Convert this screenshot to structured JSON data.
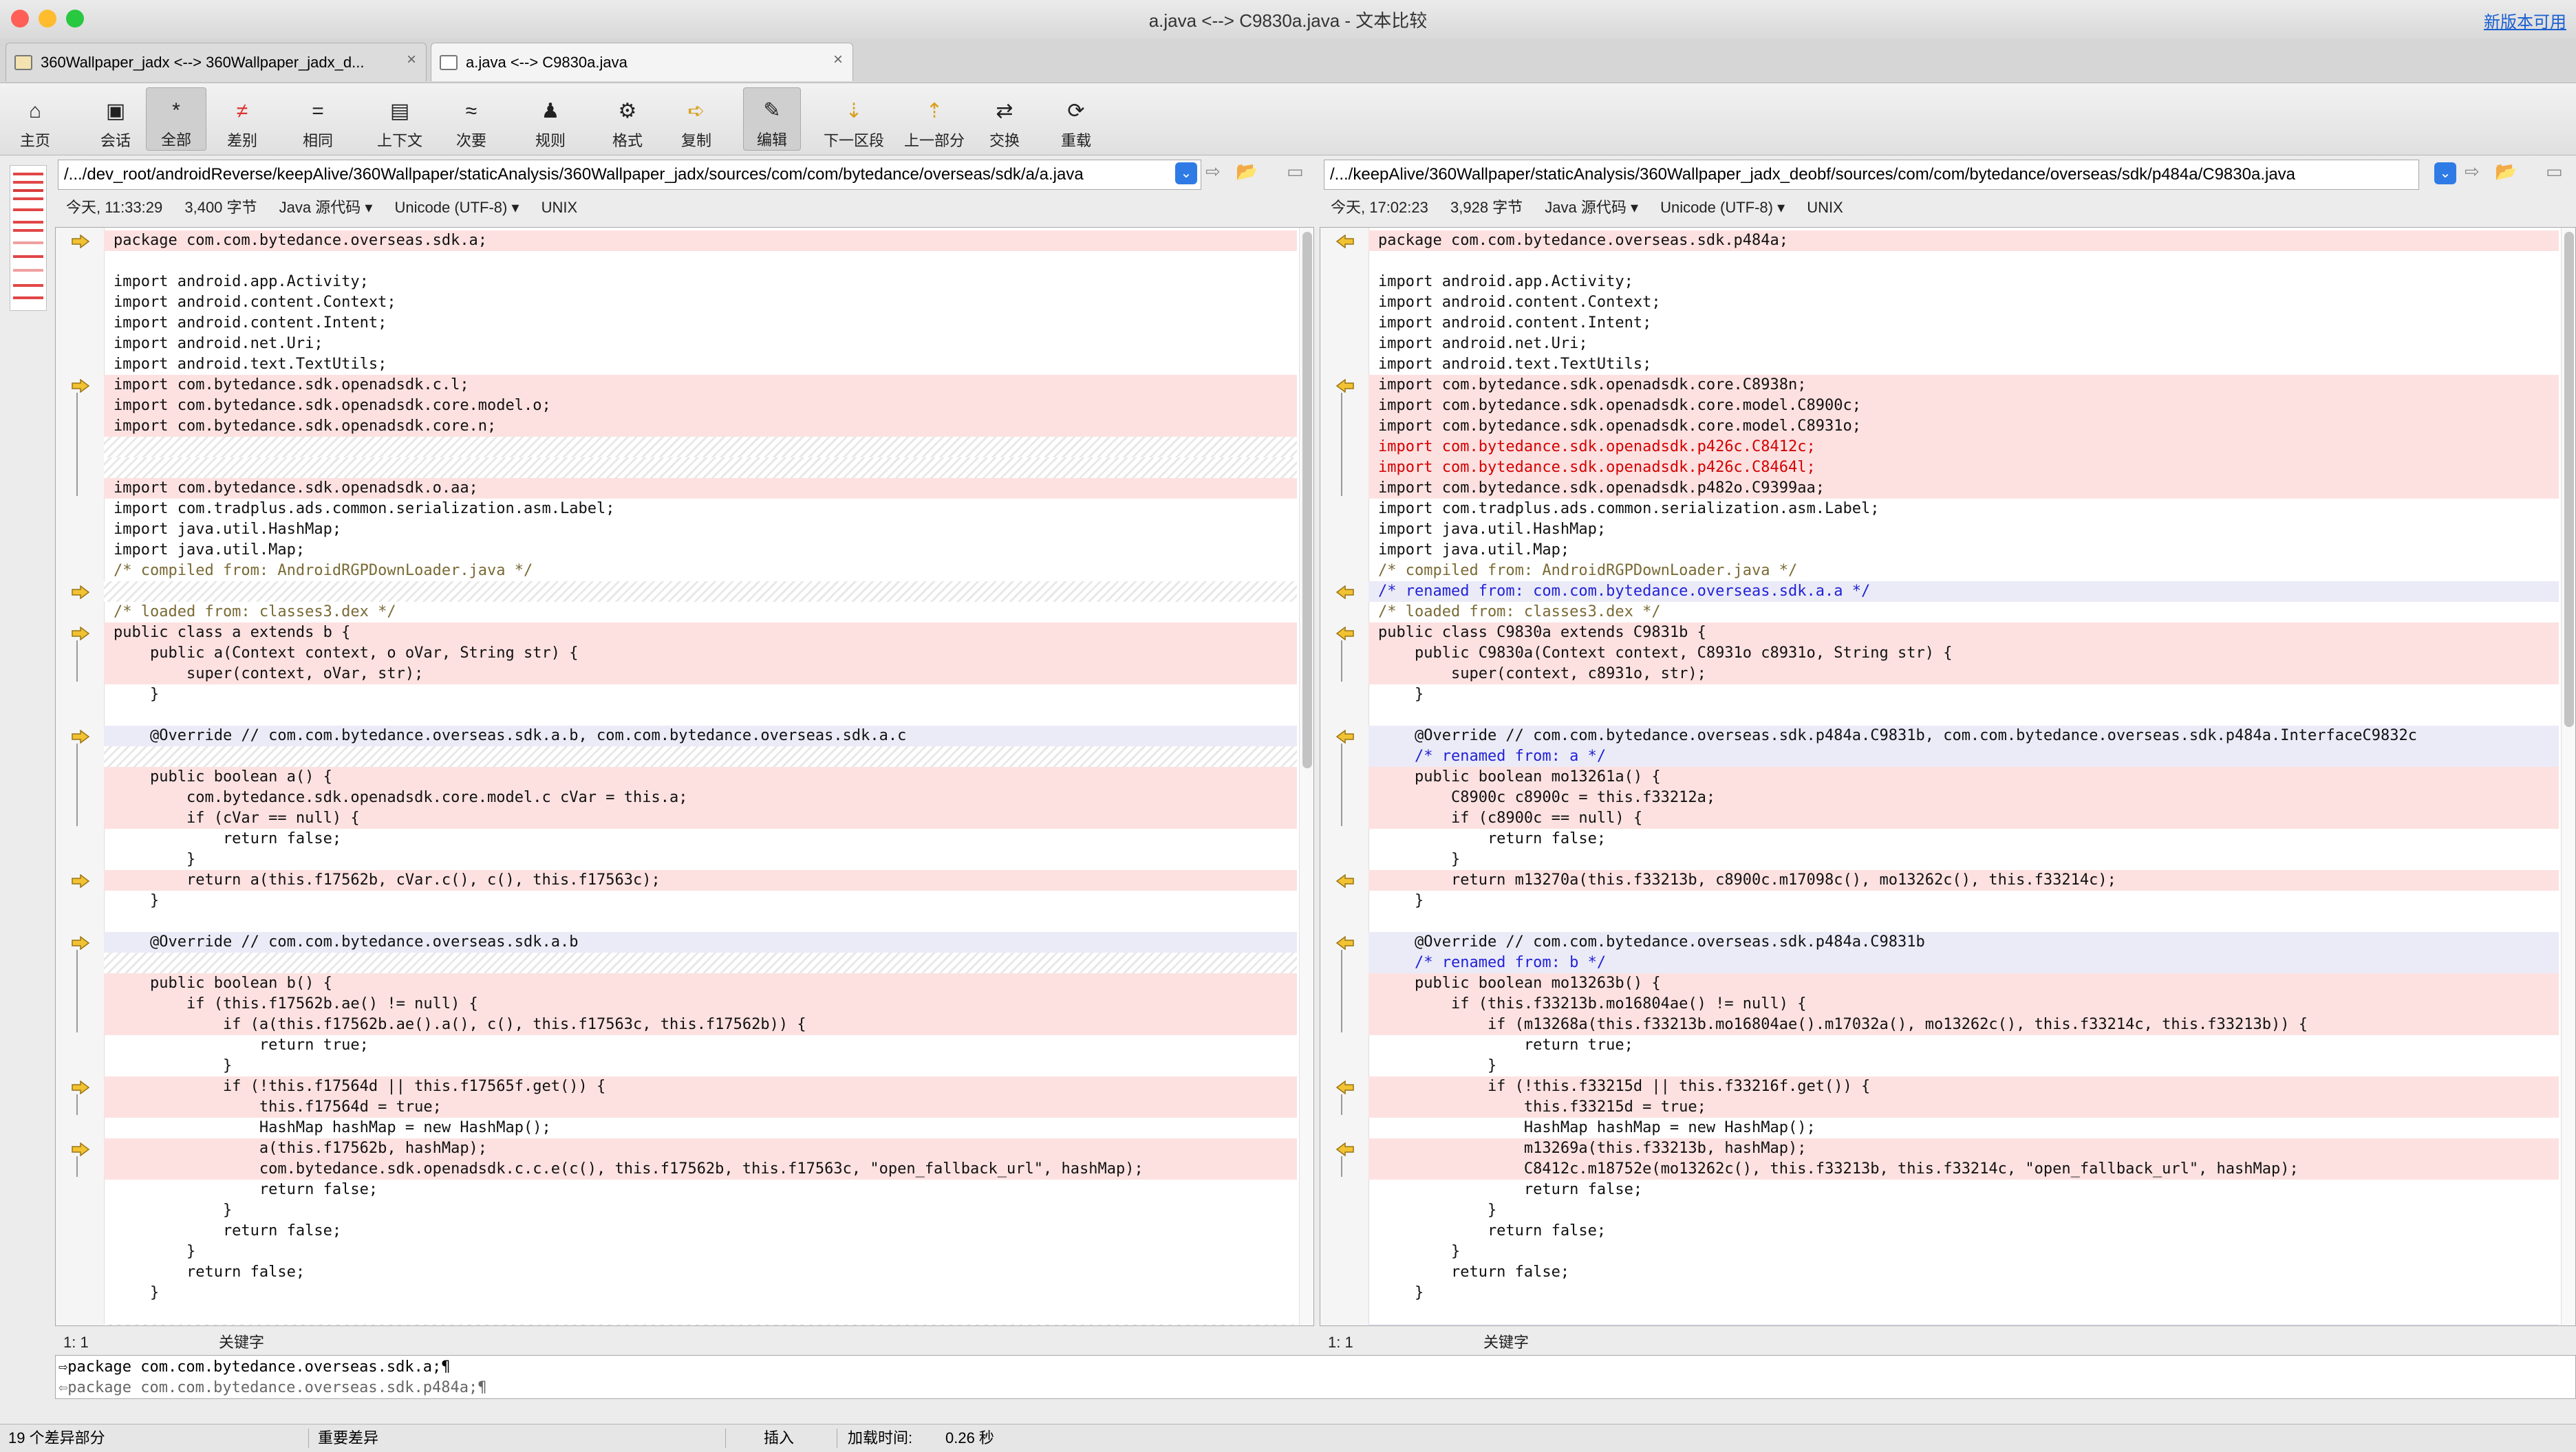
{
  "window": {
    "title": "a.java <--> C9830a.java - 文本比较",
    "new_version": "新版本可用",
    "traffic": {
      "close": "#ff5f57",
      "min": "#febc2e",
      "max": "#28c840"
    }
  },
  "tabs": [
    {
      "label": "360Wallpaper_jadx <--> 360Wallpaper_jadx_d...",
      "close": "×"
    },
    {
      "label": "a.java <--> C9830a.java",
      "close": "×"
    }
  ],
  "toolbar": [
    {
      "label": "主页",
      "icon": "home-icon",
      "glyph": "⌂"
    },
    {
      "label": "会话",
      "icon": "briefcase-icon",
      "glyph": "▣"
    },
    {
      "label": "全部",
      "icon": "asterisk-icon",
      "glyph": "*"
    },
    {
      "label": "差别",
      "icon": "not-equal-icon",
      "glyph": "≠"
    },
    {
      "label": "相同",
      "icon": "equal-icon",
      "glyph": "="
    },
    {
      "label": "上下文",
      "icon": "context-icon",
      "glyph": "▤"
    },
    {
      "label": "次要",
      "icon": "approx-icon",
      "glyph": "≈"
    },
    {
      "label": "规则",
      "icon": "person-icon",
      "glyph": "♟"
    },
    {
      "label": "格式",
      "icon": "gear-icon",
      "glyph": "⚙"
    },
    {
      "label": "复制",
      "icon": "arrow-right-icon",
      "glyph": "➪"
    },
    {
      "label": "编辑",
      "icon": "pencil-icon",
      "glyph": "✎"
    },
    {
      "label": "下一区段",
      "icon": "arrow-down-icon",
      "glyph": "⇣"
    },
    {
      "label": "上一部分",
      "icon": "arrow-up-icon",
      "glyph": "⇡"
    },
    {
      "label": "交换",
      "icon": "swap-icon",
      "glyph": "⇄"
    },
    {
      "label": "重载",
      "icon": "reload-icon",
      "glyph": "⟳"
    }
  ],
  "left": {
    "path": "/.../dev_root/androidReverse/keepAlive/360Wallpaper/staticAnalysis/360Wallpaper_jadx/sources/com/com/bytedance/overseas/sdk/a/a.java",
    "date": "今天, 11:33:29",
    "size": "3,400 字节",
    "type": "Java 源代码",
    "encoding": "Unicode (UTF-8)",
    "eol": "UNIX",
    "position": "1: 1",
    "keyword": "关键字"
  },
  "right": {
    "path": "/.../keepAlive/360Wallpaper/staticAnalysis/360Wallpaper_jadx_deobf/sources/com/com/bytedance/overseas/sdk/p484a/C9830a.java",
    "date": "今天, 17:02:23",
    "size": "3,928 字节",
    "type": "Java 源代码",
    "encoding": "Unicode (UTF-8)",
    "eol": "UNIX",
    "position": "1: 1",
    "keyword": "关键字"
  },
  "left_lines": [
    {
      "k": "diff",
      "a": 1,
      "t": "package com.com.bytedance.overseas.sdk.a;"
    },
    {
      "k": "",
      "t": ""
    },
    {
      "k": "",
      "t": "import android.app.Activity;"
    },
    {
      "k": "",
      "t": "import android.content.Context;"
    },
    {
      "k": "",
      "t": "import android.content.Intent;"
    },
    {
      "k": "",
      "t": "import android.net.Uri;"
    },
    {
      "k": "",
      "t": "import android.text.TextUtils;"
    },
    {
      "k": "diff",
      "a": 1,
      "t": "import com.bytedance.sdk.openadsdk.c.l;"
    },
    {
      "k": "diff",
      "t": "import com.bytedance.sdk.openadsdk.core.model.o;"
    },
    {
      "k": "diff",
      "t": "import com.bytedance.sdk.openadsdk.core.n;"
    },
    {
      "k": "gap",
      "t": ""
    },
    {
      "k": "gap",
      "t": ""
    },
    {
      "k": "diff",
      "t": "import com.bytedance.sdk.openadsdk.o.aa;"
    },
    {
      "k": "",
      "t": "import com.tradplus.ads.common.serialization.asm.Label;"
    },
    {
      "k": "",
      "t": "import java.util.HashMap;"
    },
    {
      "k": "",
      "t": "import java.util.Map;"
    },
    {
      "k": "cmt",
      "t": "/* compiled from: AndroidRGPDownLoader.java */"
    },
    {
      "k": "gap",
      "a": 1,
      "t": ""
    },
    {
      "k": "cmt",
      "t": "/* loaded from: classes3.dex */"
    },
    {
      "k": "diff",
      "a": 1,
      "t": "public class a extends b {"
    },
    {
      "k": "diff",
      "t": "    public a(Context context, o oVar, String str) {"
    },
    {
      "k": "diff",
      "t": "        super(context, oVar, str);"
    },
    {
      "k": "",
      "t": "    }"
    },
    {
      "k": "",
      "t": ""
    },
    {
      "k": "mod",
      "a": 1,
      "t": "    @Override // com.com.bytedance.overseas.sdk.a.b, com.com.bytedance.overseas.sdk.a.c"
    },
    {
      "k": "gap",
      "t": ""
    },
    {
      "k": "diff",
      "t": "    public boolean a() {"
    },
    {
      "k": "diff",
      "t": "        com.bytedance.sdk.openadsdk.core.model.c cVar = this.a;"
    },
    {
      "k": "diff",
      "t": "        if (cVar == null) {"
    },
    {
      "k": "",
      "t": "            return false;"
    },
    {
      "k": "",
      "t": "        }"
    },
    {
      "k": "diff",
      "a": 1,
      "t": "        return a(this.f17562b, cVar.c(), c(), this.f17563c);"
    },
    {
      "k": "",
      "t": "    }"
    },
    {
      "k": "",
      "t": ""
    },
    {
      "k": "mod",
      "a": 1,
      "t": "    @Override // com.com.bytedance.overseas.sdk.a.b"
    },
    {
      "k": "gap",
      "t": ""
    },
    {
      "k": "diff",
      "t": "    public boolean b() {"
    },
    {
      "k": "diff",
      "t": "        if (this.f17562b.ae() != null) {"
    },
    {
      "k": "diff",
      "t": "            if (a(this.f17562b.ae().a(), c(), this.f17563c, this.f17562b)) {"
    },
    {
      "k": "",
      "t": "                return true;"
    },
    {
      "k": "",
      "t": "            }"
    },
    {
      "k": "diff",
      "a": 1,
      "t": "            if (!this.f17564d || this.f17565f.get()) {"
    },
    {
      "k": "diff",
      "t": "                this.f17564d = true;"
    },
    {
      "k": "",
      "t": "                HashMap hashMap = new HashMap();"
    },
    {
      "k": "diff",
      "a": 1,
      "t": "                a(this.f17562b, hashMap);"
    },
    {
      "k": "diff",
      "t": "                com.bytedance.sdk.openadsdk.c.c.e(c(), this.f17562b, this.f17563c, \"open_fallback_url\", hashMap);"
    },
    {
      "k": "",
      "t": "                return false;"
    },
    {
      "k": "",
      "t": "            }"
    },
    {
      "k": "",
      "t": "            return false;"
    },
    {
      "k": "",
      "t": "        }"
    },
    {
      "k": "",
      "t": "        return false;"
    },
    {
      "k": "",
      "t": "    }"
    },
    {
      "k": "",
      "t": ""
    },
    {
      "k": "gap",
      "a": 1,
      "t": ""
    }
  ],
  "right_lines": [
    {
      "k": "diff",
      "a": 1,
      "t": "package com.com.bytedance.overseas.sdk.p484a;"
    },
    {
      "k": "",
      "t": ""
    },
    {
      "k": "",
      "t": "import android.app.Activity;"
    },
    {
      "k": "",
      "t": "import android.content.Context;"
    },
    {
      "k": "",
      "t": "import android.content.Intent;"
    },
    {
      "k": "",
      "t": "import android.net.Uri;"
    },
    {
      "k": "",
      "t": "import android.text.TextUtils;"
    },
    {
      "k": "diff",
      "a": 1,
      "t": "import com.bytedance.sdk.openadsdk.core.C8938n;"
    },
    {
      "k": "diff",
      "t": "import com.bytedance.sdk.openadsdk.core.model.C8900c;"
    },
    {
      "k": "diff",
      "t": "import com.bytedance.sdk.openadsdk.core.model.C8931o;"
    },
    {
      "k": "diff",
      "r": 1,
      "t": "import com.bytedance.sdk.openadsdk.p426c.C8412c;"
    },
    {
      "k": "diff",
      "r": 1,
      "t": "import com.bytedance.sdk.openadsdk.p426c.C8464l;"
    },
    {
      "k": "diff",
      "t": "import com.bytedance.sdk.openadsdk.p482o.C9399aa;"
    },
    {
      "k": "",
      "t": "import com.tradplus.ads.common.serialization.asm.Label;"
    },
    {
      "k": "",
      "t": "import java.util.HashMap;"
    },
    {
      "k": "",
      "t": "import java.util.Map;"
    },
    {
      "k": "cmt",
      "t": "/* compiled from: AndroidRGPDownLoader.java */"
    },
    {
      "k": "mod",
      "a": 1,
      "b": 1,
      "t": "/* renamed from: com.com.bytedance.overseas.sdk.a.a */"
    },
    {
      "k": "cmt",
      "t": "/* loaded from: classes3.dex */"
    },
    {
      "k": "diff",
      "a": 1,
      "t": "public class C9830a extends C9831b {"
    },
    {
      "k": "diff",
      "t": "    public C9830a(Context context, C8931o c8931o, String str) {"
    },
    {
      "k": "diff",
      "t": "        super(context, c8931o, str);"
    },
    {
      "k": "",
      "t": "    }"
    },
    {
      "k": "",
      "t": ""
    },
    {
      "k": "mod",
      "a": 1,
      "t": "    @Override // com.com.bytedance.overseas.sdk.p484a.C9831b, com.com.bytedance.overseas.sdk.p484a.InterfaceC9832c"
    },
    {
      "k": "mod",
      "b": 1,
      "t": "    /* renamed from: a */"
    },
    {
      "k": "diff",
      "t": "    public boolean mo13261a() {"
    },
    {
      "k": "diff",
      "t": "        C8900c c8900c = this.f33212a;"
    },
    {
      "k": "diff",
      "t": "        if (c8900c == null) {"
    },
    {
      "k": "",
      "t": "            return false;"
    },
    {
      "k": "",
      "t": "        }"
    },
    {
      "k": "diff",
      "a": 1,
      "t": "        return m13270a(this.f33213b, c8900c.m17098c(), mo13262c(), this.f33214c);"
    },
    {
      "k": "",
      "t": "    }"
    },
    {
      "k": "",
      "t": ""
    },
    {
      "k": "mod",
      "a": 1,
      "t": "    @Override // com.com.bytedance.overseas.sdk.p484a.C9831b"
    },
    {
      "k": "mod",
      "b": 1,
      "t": "    /* renamed from: b */"
    },
    {
      "k": "diff",
      "t": "    public boolean mo13263b() {"
    },
    {
      "k": "diff",
      "t": "        if (this.f33213b.mo16804ae() != null) {"
    },
    {
      "k": "diff",
      "t": "            if (m13268a(this.f33213b.mo16804ae().m17032a(), mo13262c(), this.f33214c, this.f33213b)) {"
    },
    {
      "k": "",
      "t": "                return true;"
    },
    {
      "k": "",
      "t": "            }"
    },
    {
      "k": "diff",
      "a": 1,
      "t": "            if (!this.f33215d || this.f33216f.get()) {"
    },
    {
      "k": "diff",
      "t": "                this.f33215d = true;"
    },
    {
      "k": "",
      "t": "                HashMap hashMap = new HashMap();"
    },
    {
      "k": "diff",
      "a": 1,
      "t": "                m13269a(this.f33213b, hashMap);"
    },
    {
      "k": "diff",
      "t": "                C8412c.m18752e(mo13262c(), this.f33213b, this.f33214c, \"open_fallback_url\", hashMap);"
    },
    {
      "k": "",
      "t": "                return false;"
    },
    {
      "k": "",
      "t": "            }"
    },
    {
      "k": "",
      "t": "            return false;"
    },
    {
      "k": "",
      "t": "        }"
    },
    {
      "k": "",
      "t": "        return false;"
    },
    {
      "k": "",
      "t": "    }"
    },
    {
      "k": "",
      "t": ""
    },
    {
      "k": "mod",
      "a": 1,
      "b": 1,
      "t": "    /* renamed from: a */"
    }
  ],
  "compare": {
    "left_line": "package com.com.bytedance.overseas.sdk.a;¶",
    "right_line": "package com.com.bytedance.overseas.sdk.p484a;¶"
  },
  "status": {
    "diff_count": "19 个差异部分",
    "importance": "重要差异",
    "mode": "插入",
    "load_label": "加载时间:",
    "load_time": "0.26 秒"
  },
  "colors": {
    "diff_bg": "#fde1e1",
    "mod_bg": "#ebebf8",
    "accent": "#2f7be6",
    "arrow": "#e9b22b"
  }
}
